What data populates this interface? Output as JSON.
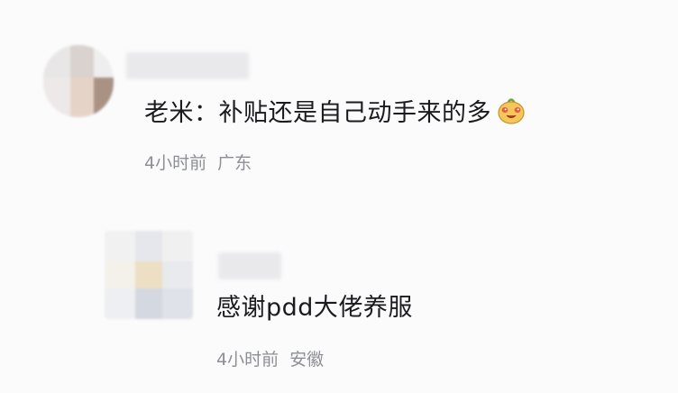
{
  "comments": [
    {
      "author_prefix": "老米：",
      "text": "补贴还是自己动手来的多",
      "emoji": "smiling-face-emoji",
      "time": "4小时前",
      "location": "广东"
    },
    {
      "text": "感谢pdd大佬养服",
      "time": "4小时前",
      "location": "安徽"
    }
  ],
  "colors": {
    "background": "#fbfbfc",
    "text": "#1b1b1f",
    "meta": "#8d8f95"
  }
}
